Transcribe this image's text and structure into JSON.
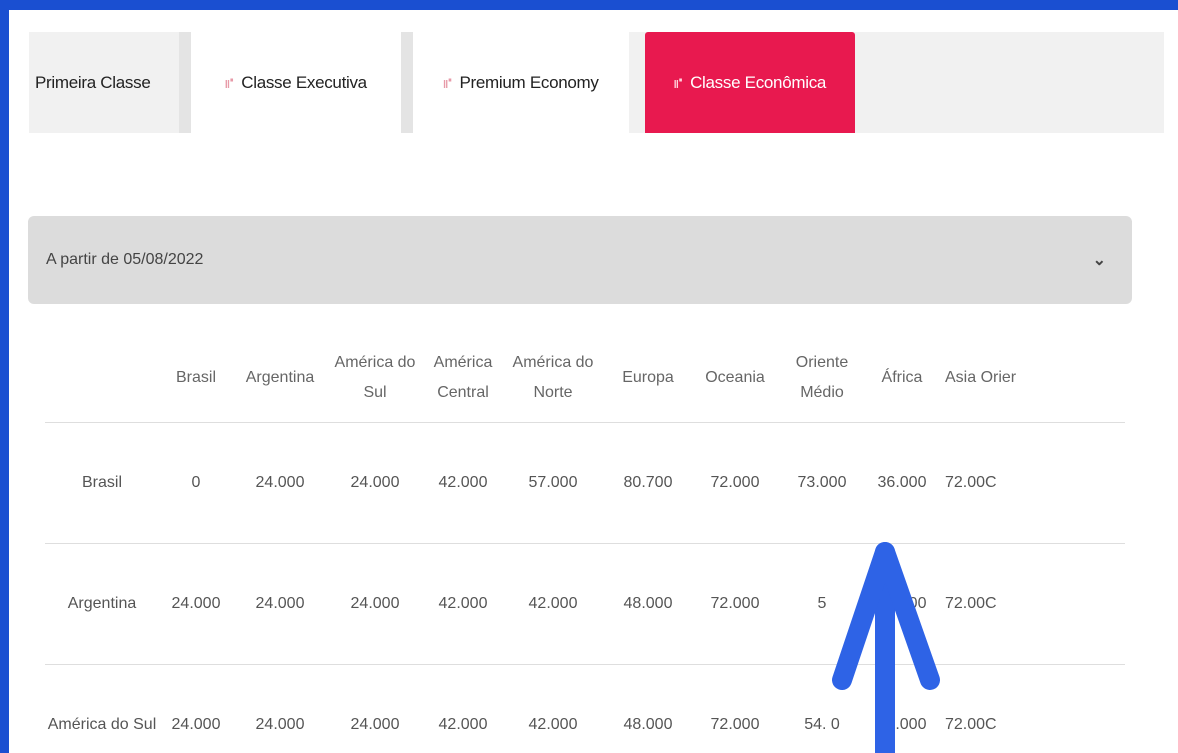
{
  "tabs": [
    {
      "label": "Primeira Classe",
      "icon": "",
      "active": false
    },
    {
      "label": "Classe Executiva",
      "icon": "seat-icon",
      "active": false
    },
    {
      "label": "Premium Economy",
      "icon": "seat-icon",
      "active": false
    },
    {
      "label": "Classe Econômica",
      "icon": "seat-icon",
      "active": true
    }
  ],
  "accordion": {
    "label": "A partir de 05/08/2022",
    "icon": "chevron-down-icon"
  },
  "table": {
    "headers": [
      "",
      "Brasil",
      "Argentina",
      "América do Sul",
      "América Central",
      "América do Norte",
      "Europa",
      "Oceania",
      "Oriente Médio",
      "África",
      "Asia Orier"
    ],
    "rows": [
      [
        "Brasil",
        "0",
        "24.000",
        "24.000",
        "42.000",
        "57.000",
        "80.700",
        "72.000",
        "73.000",
        "36.000",
        "72.00C"
      ],
      [
        "Argentina",
        "24.000",
        "24.000",
        "24.000",
        "42.000",
        "42.000",
        "48.000",
        "72.000",
        "5",
        "30.000",
        "72.00C"
      ],
      [
        "América do Sul",
        "24.000",
        "24.000",
        "24.000",
        "42.000",
        "42.000",
        "48.000",
        "72.000",
        "54.  0",
        "30.000",
        "72.00C"
      ]
    ]
  },
  "colors": {
    "border": "#1a4fd1",
    "active_tab": "#e8194f",
    "arrow": "#2e63e6"
  }
}
